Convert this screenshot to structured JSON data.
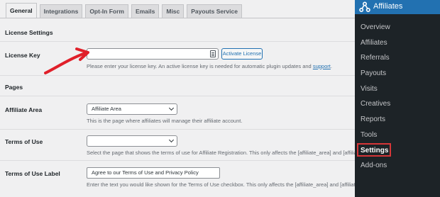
{
  "tabs": [
    {
      "label": "General",
      "active": true
    },
    {
      "label": "Integrations",
      "active": false
    },
    {
      "label": "Opt-In Form",
      "active": false
    },
    {
      "label": "Emails",
      "active": false
    },
    {
      "label": "Misc",
      "active": false
    },
    {
      "label": "Payouts Service",
      "active": false
    }
  ],
  "license": {
    "section_title": "License Settings",
    "label": "License Key",
    "input_value": "",
    "activate_label": "Activate License",
    "description": "Please enter your license key. An active license key is needed for automatic plugin updates and ",
    "support_link": "support",
    "description_end": "."
  },
  "pages": {
    "section_title": "Pages",
    "affiliate_area": {
      "label": "Affiliate Area",
      "selected": "Affiliate Area",
      "description": "This is the page where affiliates will manage their affiliate account."
    },
    "terms": {
      "label": "Terms of Use",
      "selected": "",
      "description": "Select the page that shows the terms of use for Affiliate Registration. This only affects the [affiliate_area] and [affiliat"
    },
    "terms_label": {
      "label": "Terms of Use Label",
      "value": "Agree to our Terms of Use and Privacy Policy",
      "description": "Enter the text you would like shown for the Terms of Use checkbox. This only affects the [affiliate_area] and [affiliate_registration] shortcodes."
    }
  },
  "menu": {
    "title": "Affiliates",
    "logo_icon": "affiliatewp-logo-icon",
    "items": [
      {
        "label": "Overview",
        "current": false
      },
      {
        "label": "Affiliates",
        "current": false
      },
      {
        "label": "Referrals",
        "current": false
      },
      {
        "label": "Payouts",
        "current": false
      },
      {
        "label": "Visits",
        "current": false
      },
      {
        "label": "Creatives",
        "current": false
      },
      {
        "label": "Reports",
        "current": false
      },
      {
        "label": "Tools",
        "current": false
      },
      {
        "label": "Settings",
        "current": true
      },
      {
        "label": "Add-ons",
        "current": false
      }
    ]
  },
  "colors": {
    "accent": "#2271b1",
    "menu_bg": "#1d2327",
    "annotation_red": "#e0202a",
    "highlight_red": "#d63638"
  }
}
